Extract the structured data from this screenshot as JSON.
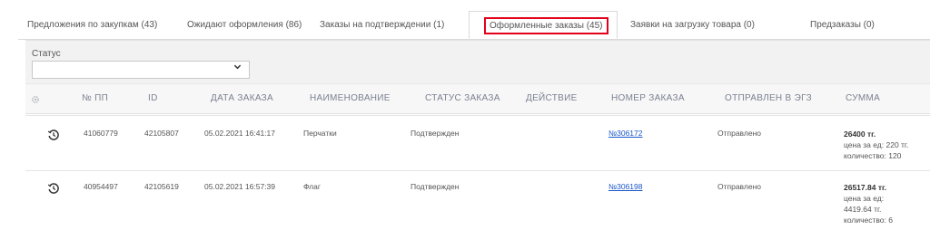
{
  "tabs": [
    {
      "label": "Предложения по закупкам (43)"
    },
    {
      "label": "Ожидают оформления (86)"
    },
    {
      "label": "Заказы на подтверждении (1)"
    },
    {
      "label": "Оформленные заказы (45)",
      "active": true
    },
    {
      "label": "Заявки на загрузку товара (0)"
    },
    {
      "label": "Предзаказы (0)"
    }
  ],
  "filter": {
    "status_label": "Статус",
    "status_value": ""
  },
  "columns": [
    "№ ПП",
    "ID",
    "ДАТА ЗАКАЗА",
    "НАИМЕНОВАНИЕ",
    "СТАТУС ЗАКАЗА",
    "ДЕЙСТВИЕ",
    "НОМЕР ЗАКАЗА",
    "ОТПРАВЛЕН В ЭГЗ",
    "СУММА"
  ],
  "rows": [
    {
      "pp": "41060779",
      "id": "42105807",
      "date": "05.02.2021 16:41:17",
      "name": "Перчатки",
      "status": "Подтвержден",
      "action": "",
      "order_no": "№306172",
      "sent": "Отправлено",
      "sum_total": "26400 тг.",
      "sum_lines": [
        "цена за ед: 220 тг.",
        "количество: 120"
      ]
    },
    {
      "pp": "40954497",
      "id": "42105619",
      "date": "05.02.2021 16:57:39",
      "name": "Флаг",
      "status": "Подтвержден",
      "action": "",
      "order_no": "№306198",
      "sent": "Отправлено",
      "sum_total": "26517.84 тг.",
      "sum_lines": [
        "цена за ед:",
        "4419.64 тг.",
        "количество: 6"
      ]
    }
  ],
  "colors": {
    "active_outline": "#e3001b",
    "link": "#1a56c8",
    "header_text": "#7a8190"
  },
  "icons": {
    "settings": "gear-icon",
    "history": "history-icon",
    "dropdown": "chevron-down-icon"
  }
}
